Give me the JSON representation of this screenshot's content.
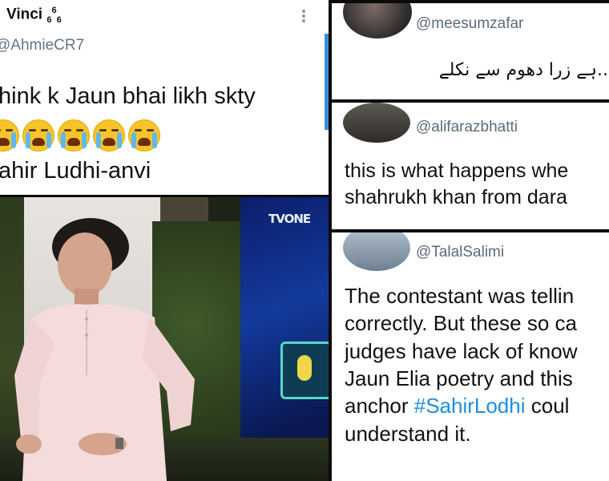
{
  "tweet_top_left": {
    "display_name": "Vinci",
    "name_suffix": "6",
    "handle": "AhmieCR7",
    "line1": "hink k Jaun bhai likh skty",
    "emoji_name": "loudly-crying-face",
    "emoji_count": 5,
    "line2": "ahir Ludhi-anvi"
  },
  "video_frame": {
    "logo": "TVONE",
    "score_badge": "0"
  },
  "tweet_mesum": {
    "handle": "@meesumzafar",
    "text": "...ہے زرا دھوم سے نکلے"
  },
  "tweet_alifaraz": {
    "handle": "@alifarazbhatti",
    "lines": [
      "this is what happens whe",
      "shahrukh khan from dara"
    ]
  },
  "tweet_talal": {
    "handle": "@TalalSalimi",
    "lines": [
      "The contestant was tellin",
      "correctly. But these so ca",
      "judges have lack of know",
      "Jaun Elia poetry and this"
    ],
    "line5_prefix": "anchor ",
    "hashtag": "#SahirLodhi",
    "line5_suffix": " coul",
    "line6": "understand it."
  },
  "colors": {
    "hashtag": "#1d8fe0",
    "handle": "#5b6b78",
    "accent_bar": "#3a8fd6",
    "background": "#0b0b0b"
  }
}
